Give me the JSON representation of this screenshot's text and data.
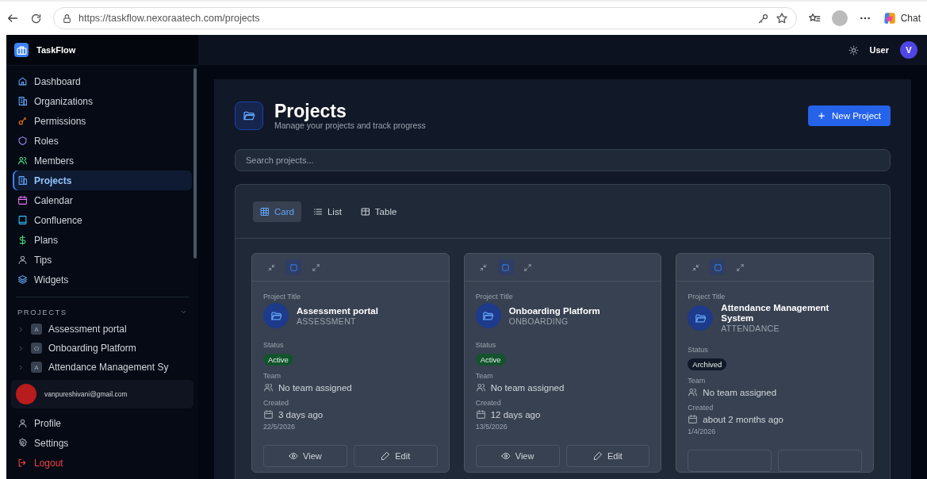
{
  "browser": {
    "url": "https://taskflow.nexoraatech.com/projects",
    "chat_label": "Chat"
  },
  "sidebar": {
    "brand": "TaskFlow",
    "nav": [
      {
        "label": "Dashboard",
        "selected": false
      },
      {
        "label": "Organizations",
        "selected": false
      },
      {
        "label": "Permissions",
        "selected": false
      },
      {
        "label": "Roles",
        "selected": false
      },
      {
        "label": "Members",
        "selected": false
      },
      {
        "label": "Projects",
        "selected": true
      },
      {
        "label": "Calendar",
        "selected": false
      },
      {
        "label": "Confluence",
        "selected": false
      },
      {
        "label": "Plans",
        "selected": false
      },
      {
        "label": "Tips",
        "selected": false
      },
      {
        "label": "Widgets",
        "selected": false
      }
    ],
    "projects_heading": "PROJECTS",
    "projects_expanded": true,
    "projects": [
      {
        "initial": "A",
        "name": "Assessment portal"
      },
      {
        "initial": "O",
        "name": "Onboarding Platform"
      },
      {
        "initial": "A",
        "name": "Attendance Management Sy"
      }
    ],
    "user_email": "vanpureshivani@gmail.com",
    "bottom": [
      {
        "label": "Profile",
        "kind": "normal"
      },
      {
        "label": "Settings",
        "kind": "normal"
      },
      {
        "label": "Logout",
        "kind": "danger"
      }
    ]
  },
  "topbar": {
    "user_label": "User",
    "avatar_initial": "V"
  },
  "page": {
    "title": "Projects",
    "subtitle": "Manage your projects and track progress",
    "new_button": "New Project",
    "search": {
      "placeholder": "Search projects..."
    }
  },
  "view_tabs": [
    {
      "label": "Card",
      "selected": true
    },
    {
      "label": "List",
      "selected": false
    },
    {
      "label": "Table",
      "selected": false
    }
  ],
  "cards": [
    {
      "size_modes": [
        {
          "selected": false
        },
        {
          "selected": true
        },
        {
          "selected": false
        }
      ],
      "title_label": "Project Title",
      "name": "Assessment portal",
      "code": "ASSESSMENT",
      "status_label": "Status",
      "status": "Active",
      "color": "#14532d",
      "team_label": "Team",
      "team": "No team assigned",
      "created_label": "Created",
      "created": "3 days ago",
      "date": "22/5/2026",
      "actions": [
        "View",
        "Edit"
      ]
    },
    {
      "size_modes": [
        {
          "selected": false
        },
        {
          "selected": true
        },
        {
          "selected": false
        }
      ],
      "title_label": "Project Title",
      "name": "Onboarding Platform",
      "code": "ONBOARDING",
      "status_label": "Status",
      "status": "Active",
      "color": "#14532d",
      "team_label": "Team",
      "team": "No team assigned",
      "created_label": "Created",
      "created": "12 days ago",
      "date": "13/5/2026",
      "actions": [
        "View",
        "Edit"
      ]
    },
    {
      "size_modes": [
        {
          "selected": false
        },
        {
          "selected": true
        },
        {
          "selected": false
        }
      ],
      "title_label": "Project Title",
      "name": "Attendance Management System",
      "code": "ATTENDANCE",
      "status_label": "Status",
      "status": "Archived",
      "color": "#111827",
      "team_label": "Team",
      "team": "No team assigned",
      "created_label": "Created",
      "created": "about 2 months ago",
      "date": "1/4/2026"
    }
  ]
}
